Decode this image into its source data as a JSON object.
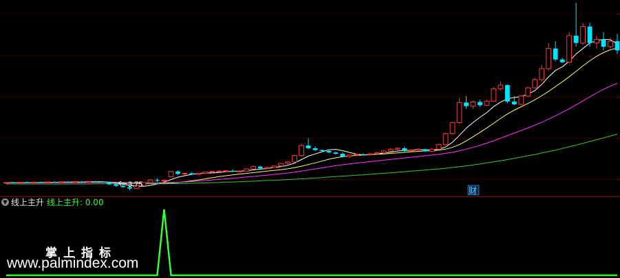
{
  "colors": {
    "background": "#000000",
    "grid": "#7a0000",
    "up": "#ff3c3c",
    "down": "#00e5ff",
    "ma_white": "#ffffff",
    "ma_yellow": "#ffff66",
    "ma_magenta": "#ff33ff",
    "ma_green": "#33cc33",
    "indicator": "#33ff33",
    "finance_marker": "#66ccff"
  },
  "main_panel": {
    "low_price_label": "3.75",
    "finance_marker": "财"
  },
  "indicator_panel": {
    "collapse_icon": "chevron-down-icon",
    "name": "线上主升",
    "value_label": "线上主升: 0.00"
  },
  "watermark": {
    "title": "掌上指标",
    "url": "www.palmindex.com"
  },
  "chart_data": [
    {
      "type": "candlestick",
      "x_count": 90,
      "y_range": [
        3.5,
        14.0
      ],
      "grid": true,
      "annotations": [
        "3.75",
        "财"
      ],
      "candles": [
        [
          4.15,
          4.2,
          4.12,
          4.18
        ],
        [
          4.18,
          4.22,
          4.15,
          4.16
        ],
        [
          4.16,
          4.2,
          4.12,
          4.19
        ],
        [
          4.19,
          4.24,
          4.16,
          4.17
        ],
        [
          4.17,
          4.21,
          4.13,
          4.2
        ],
        [
          4.2,
          4.24,
          4.16,
          4.18
        ],
        [
          4.18,
          4.22,
          4.14,
          4.21
        ],
        [
          4.21,
          4.25,
          4.17,
          4.19
        ],
        [
          4.19,
          4.23,
          4.15,
          4.22
        ],
        [
          4.22,
          4.26,
          4.18,
          4.2
        ],
        [
          4.2,
          4.24,
          4.16,
          4.23
        ],
        [
          4.23,
          4.27,
          4.19,
          4.21
        ],
        [
          4.21,
          4.25,
          4.17,
          4.24
        ],
        [
          4.24,
          4.28,
          4.2,
          4.22
        ],
        [
          4.22,
          4.26,
          4.18,
          4.2
        ],
        [
          4.2,
          4.22,
          4.05,
          4.08
        ],
        [
          4.08,
          4.12,
          3.95,
          4.0
        ],
        [
          4.0,
          4.05,
          3.9,
          3.93
        ],
        [
          3.93,
          3.98,
          3.75,
          3.85
        ],
        [
          3.85,
          4.02,
          3.82,
          4.0
        ],
        [
          4.0,
          4.2,
          3.98,
          4.18
        ],
        [
          4.18,
          4.35,
          4.15,
          4.32
        ],
        [
          4.32,
          4.4,
          4.2,
          4.28
        ],
        [
          4.28,
          4.33,
          4.22,
          4.3
        ],
        [
          4.5,
          4.8,
          4.48,
          4.78
        ],
        [
          4.78,
          4.85,
          4.6,
          4.65
        ],
        [
          4.65,
          4.72,
          4.58,
          4.68
        ],
        [
          4.68,
          4.75,
          4.6,
          4.62
        ],
        [
          4.62,
          4.7,
          4.58,
          4.68
        ],
        [
          4.68,
          4.78,
          4.64,
          4.75
        ],
        [
          4.75,
          4.82,
          4.68,
          4.78
        ],
        [
          4.78,
          4.85,
          4.72,
          4.8
        ],
        [
          4.8,
          4.86,
          4.74,
          4.82
        ],
        [
          4.82,
          4.9,
          4.75,
          4.78
        ],
        [
          4.78,
          4.82,
          4.72,
          4.8
        ],
        [
          4.8,
          4.95,
          4.78,
          4.92
        ],
        [
          4.92,
          5.1,
          4.9,
          5.05
        ],
        [
          5.05,
          5.1,
          4.92,
          4.95
        ],
        [
          4.95,
          5.05,
          4.9,
          5.0
        ],
        [
          5.0,
          5.1,
          4.98,
          5.08
        ],
        [
          5.08,
          5.25,
          5.05,
          5.22
        ],
        [
          5.22,
          5.35,
          5.18,
          5.3
        ],
        [
          5.3,
          5.7,
          5.28,
          5.65
        ],
        [
          5.65,
          6.3,
          5.6,
          6.2
        ],
        [
          6.2,
          6.6,
          6.0,
          6.05
        ],
        [
          6.05,
          6.15,
          5.9,
          5.95
        ],
        [
          5.95,
          6.0,
          5.85,
          5.9
        ],
        [
          5.9,
          5.98,
          5.78,
          5.82
        ],
        [
          5.82,
          5.88,
          5.7,
          5.75
        ],
        [
          5.75,
          5.82,
          5.55,
          5.6
        ],
        [
          5.6,
          5.72,
          5.52,
          5.68
        ],
        [
          5.68,
          5.75,
          5.6,
          5.72
        ],
        [
          5.72,
          5.78,
          5.65,
          5.7
        ],
        [
          5.7,
          5.8,
          5.65,
          5.75
        ],
        [
          5.75,
          5.85,
          5.7,
          5.8
        ],
        [
          5.8,
          5.95,
          5.75,
          5.9
        ],
        [
          5.9,
          6.05,
          5.85,
          6.0
        ],
        [
          6.0,
          6.1,
          5.95,
          6.05
        ],
        [
          6.05,
          6.15,
          5.85,
          5.9
        ],
        [
          5.9,
          6.0,
          5.82,
          5.95
        ],
        [
          5.95,
          6.05,
          5.88,
          6.0
        ],
        [
          6.0,
          6.02,
          5.85,
          5.88
        ],
        [
          5.88,
          6.05,
          5.85,
          6.0
        ],
        [
          6.0,
          6.3,
          5.98,
          6.25
        ],
        [
          6.25,
          6.9,
          6.2,
          6.85
        ],
        [
          6.85,
          7.5,
          6.8,
          7.45
        ],
        [
          7.45,
          8.8,
          7.4,
          8.55
        ],
        [
          8.55,
          8.9,
          8.2,
          8.35
        ],
        [
          8.35,
          8.65,
          8.2,
          8.58
        ],
        [
          8.58,
          8.7,
          8.3,
          8.4
        ],
        [
          8.4,
          8.7,
          8.35,
          8.62
        ],
        [
          8.62,
          9.4,
          8.6,
          9.3
        ],
        [
          9.3,
          9.7,
          9.2,
          9.5
        ],
        [
          9.5,
          9.55,
          8.5,
          8.6
        ],
        [
          8.6,
          8.9,
          8.4,
          8.45
        ],
        [
          8.45,
          8.95,
          8.4,
          8.9
        ],
        [
          8.9,
          9.4,
          8.85,
          9.35
        ],
        [
          9.35,
          9.9,
          9.3,
          9.8
        ],
        [
          9.8,
          10.6,
          9.7,
          10.4
        ],
        [
          10.4,
          11.8,
          10.3,
          11.5
        ],
        [
          11.5,
          11.9,
          10.8,
          10.9
        ],
        [
          10.9,
          11.0,
          10.7,
          10.75
        ],
        [
          10.75,
          12.4,
          10.7,
          12.2
        ],
        [
          12.2,
          14.0,
          11.6,
          11.8
        ],
        [
          11.8,
          12.9,
          11.7,
          12.7
        ],
        [
          12.7,
          12.9,
          11.6,
          11.8
        ],
        [
          11.8,
          12.2,
          11.5,
          12.0
        ],
        [
          12.0,
          12.4,
          11.4,
          11.6
        ],
        [
          11.6,
          12.1,
          11.5,
          11.9
        ],
        [
          11.9,
          12.3,
          11.2,
          11.4
        ]
      ],
      "moving_averages": [
        {
          "color": "#ffffff",
          "values": [
            4.17,
            4.17,
            4.18,
            4.18,
            4.18,
            4.18,
            4.19,
            4.19,
            4.2,
            4.2,
            4.21,
            4.21,
            4.22,
            4.22,
            4.22,
            4.19,
            4.14,
            4.08,
            4.03,
            3.99,
            3.97,
            4.02,
            4.1,
            4.2,
            4.34,
            4.47,
            4.55,
            4.62,
            4.68,
            4.7,
            4.7,
            4.73,
            4.77,
            4.79,
            4.8,
            4.82,
            4.87,
            4.91,
            4.94,
            5.0,
            5.05,
            5.12,
            5.24,
            5.43,
            5.62,
            5.74,
            5.86,
            5.97,
            5.99,
            5.92,
            5.82,
            5.73,
            5.69,
            5.69,
            5.73,
            5.79,
            5.84,
            5.9,
            5.93,
            5.95,
            5.97,
            5.97,
            5.96,
            5.99,
            6.12,
            6.38,
            6.75,
            7.15,
            7.46,
            7.74,
            8.0,
            8.33,
            8.57,
            8.76,
            8.82,
            8.88,
            9.0,
            9.2,
            9.54,
            9.95,
            10.3,
            10.5,
            10.8,
            11.2,
            11.5,
            11.8,
            11.93,
            12.0,
            11.98,
            11.75
          ]
        },
        {
          "color": "#ffff66",
          "values": [
            4.17,
            4.17,
            4.17,
            4.17,
            4.17,
            4.17,
            4.18,
            4.18,
            4.18,
            4.18,
            4.19,
            4.19,
            4.19,
            4.2,
            4.2,
            4.2,
            4.19,
            4.18,
            4.16,
            4.15,
            4.13,
            4.12,
            4.12,
            4.13,
            4.15,
            4.18,
            4.22,
            4.27,
            4.32,
            4.38,
            4.44,
            4.5,
            4.55,
            4.6,
            4.64,
            4.68,
            4.72,
            4.76,
            4.8,
            4.84,
            4.88,
            4.93,
            4.99,
            5.07,
            5.16,
            5.25,
            5.35,
            5.45,
            5.53,
            5.59,
            5.63,
            5.66,
            5.68,
            5.7,
            5.72,
            5.74,
            5.77,
            5.8,
            5.83,
            5.86,
            5.88,
            5.9,
            5.92,
            5.95,
            6.0,
            6.1,
            6.25,
            6.45,
            6.68,
            6.92,
            7.16,
            7.42,
            7.68,
            7.92,
            8.13,
            8.32,
            8.5,
            8.7,
            8.92,
            9.16,
            9.42,
            9.68,
            9.96,
            10.25,
            10.55,
            10.83,
            11.08,
            11.28,
            11.43,
            11.52
          ]
        },
        {
          "color": "#ff33ff",
          "values": [
            4.16,
            4.16,
            4.16,
            4.16,
            4.16,
            4.16,
            4.16,
            4.17,
            4.17,
            4.17,
            4.17,
            4.17,
            4.18,
            4.18,
            4.18,
            4.18,
            4.18,
            4.18,
            4.17,
            4.17,
            4.17,
            4.17,
            4.17,
            4.17,
            4.18,
            4.19,
            4.21,
            4.23,
            4.26,
            4.29,
            4.32,
            4.35,
            4.38,
            4.41,
            4.44,
            4.48,
            4.51,
            4.55,
            4.58,
            4.62,
            4.66,
            4.7,
            4.75,
            4.8,
            4.86,
            4.92,
            4.98,
            5.04,
            5.1,
            5.15,
            5.2,
            5.24,
            5.28,
            5.32,
            5.36,
            5.4,
            5.44,
            5.48,
            5.52,
            5.56,
            5.6,
            5.64,
            5.68,
            5.72,
            5.77,
            5.83,
            5.91,
            6.0,
            6.1,
            6.21,
            6.33,
            6.46,
            6.6,
            6.74,
            6.88,
            7.02,
            7.16,
            7.31,
            7.47,
            7.64,
            7.82,
            8.01,
            8.21,
            8.42,
            8.64,
            8.86,
            9.07,
            9.27,
            9.45,
            9.6
          ]
        },
        {
          "color": "#33cc33",
          "values": [
            4.1,
            4.1,
            4.1,
            4.1,
            4.1,
            4.1,
            4.1,
            4.1,
            4.1,
            4.1,
            4.1,
            4.1,
            4.1,
            4.11,
            4.11,
            4.11,
            4.11,
            4.11,
            4.11,
            4.11,
            4.11,
            4.11,
            4.11,
            4.11,
            4.12,
            4.12,
            4.13,
            4.14,
            4.15,
            4.16,
            4.17,
            4.18,
            4.2,
            4.21,
            4.22,
            4.24,
            4.25,
            4.27,
            4.29,
            4.3,
            4.32,
            4.34,
            4.36,
            4.38,
            4.4,
            4.43,
            4.45,
            4.48,
            4.5,
            4.53,
            4.55,
            4.58,
            4.6,
            4.63,
            4.66,
            4.68,
            4.71,
            4.74,
            4.77,
            4.8,
            4.83,
            4.86,
            4.89,
            4.92,
            4.96,
            5.0,
            5.04,
            5.09,
            5.14,
            5.19,
            5.25,
            5.31,
            5.37,
            5.43,
            5.5,
            5.57,
            5.64,
            5.71,
            5.79,
            5.87,
            5.95,
            6.04,
            6.13,
            6.22,
            6.32,
            6.42,
            6.52,
            6.62,
            6.72,
            6.82
          ]
        }
      ]
    },
    {
      "type": "line",
      "series": [
        {
          "name": "线上主升",
          "values": [
            0,
            0,
            0,
            0,
            0,
            0,
            0,
            0,
            0,
            0,
            0,
            0,
            0,
            0,
            0,
            0,
            0,
            0,
            0,
            0,
            0,
            0,
            0,
            1,
            0,
            0,
            0,
            0,
            0,
            0,
            0,
            0,
            0,
            0,
            0,
            0,
            0,
            0,
            0,
            0,
            0,
            0,
            0,
            0,
            0,
            0,
            0,
            0,
            0,
            0,
            0,
            0,
            0,
            0,
            0,
            0,
            0,
            0,
            0,
            0,
            0,
            0,
            0,
            0,
            0,
            0,
            0,
            0,
            0,
            0,
            0,
            0,
            0,
            0,
            0,
            0,
            0,
            0,
            0,
            0,
            0,
            0,
            0,
            0,
            0,
            0,
            0,
            0,
            0,
            0
          ]
        }
      ],
      "ylim": [
        0,
        1
      ]
    }
  ]
}
